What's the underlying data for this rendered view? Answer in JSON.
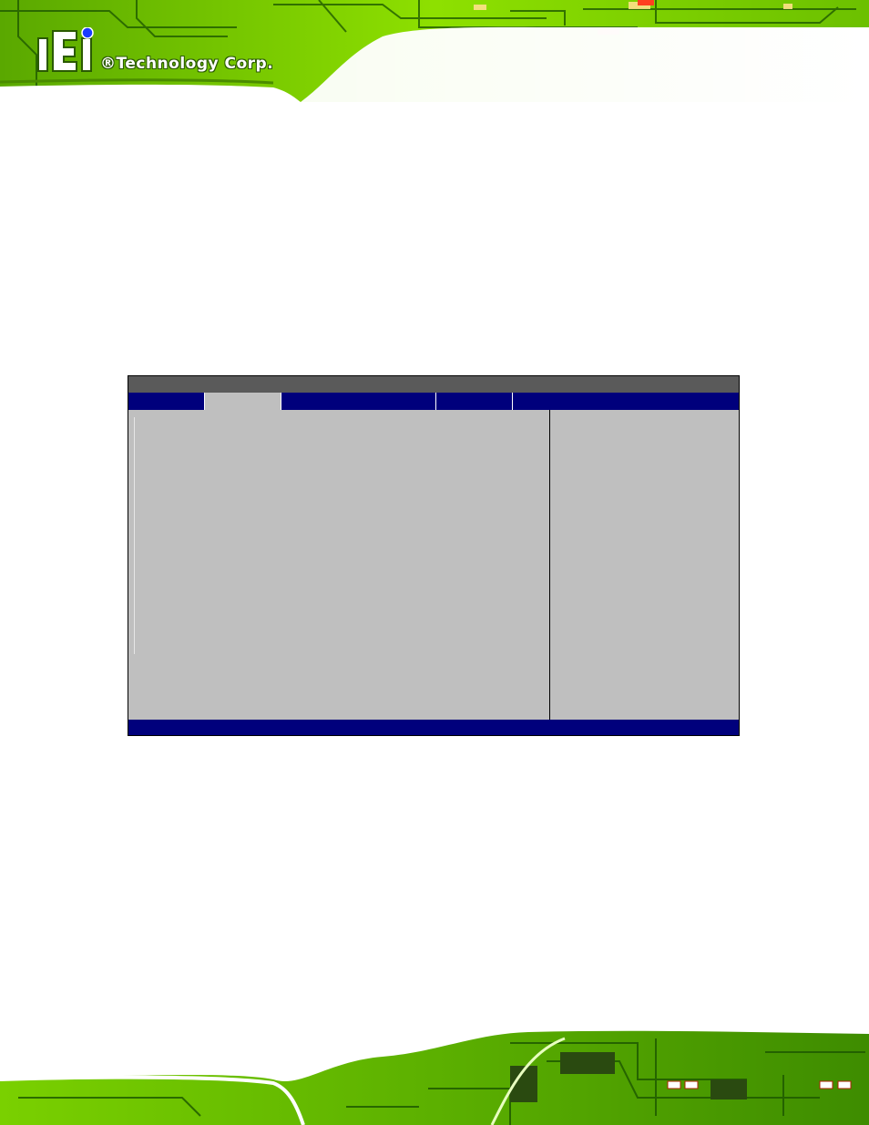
{
  "brand": {
    "logo_text": "®Technology Corp.",
    "colors": {
      "pcb_green": "#7fd000",
      "pcb_dark": "#1f5a00",
      "logo_dot": "#1a3cff"
    }
  },
  "bios_screen": {
    "tabs": [
      {
        "label": "",
        "active": false
      },
      {
        "label": "",
        "active": true
      },
      {
        "label": "",
        "active": false
      },
      {
        "label": "",
        "active": false
      },
      {
        "label": "",
        "active": false
      }
    ],
    "colors": {
      "title_bar": "#5a5a5a",
      "menu_bar": "#00007c",
      "body": "#bfbfbf",
      "status_bar": "#00007c"
    }
  }
}
